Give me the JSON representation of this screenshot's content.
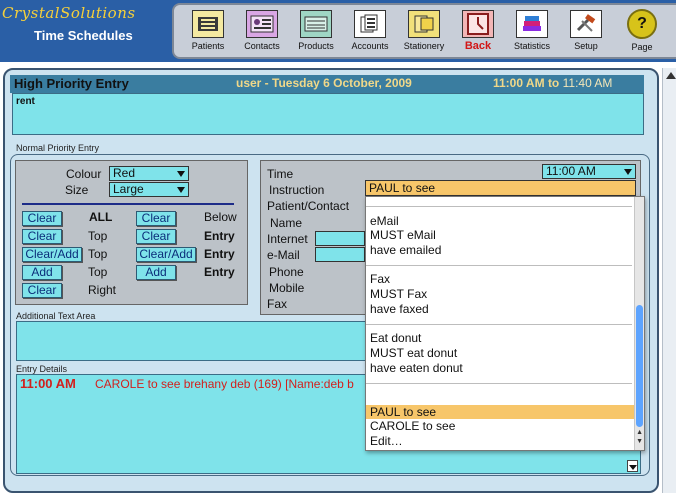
{
  "app": {
    "brand": "CrystalSolutions",
    "module_title": "Time Schedules"
  },
  "toolbar": {
    "buttons": [
      {
        "label": "Patients",
        "icon": "patients-icon"
      },
      {
        "label": "Contacts",
        "icon": "contacts-icon"
      },
      {
        "label": "Products",
        "icon": "products-icon"
      },
      {
        "label": "Accounts",
        "icon": "accounts-icon"
      },
      {
        "label": "Stationery",
        "icon": "stationery-icon"
      },
      {
        "label": "Back",
        "icon": "back-icon"
      },
      {
        "label": "Statistics",
        "icon": "statistics-icon"
      },
      {
        "label": "Setup",
        "icon": "setup-icon"
      },
      {
        "label": "Page",
        "icon": "page-help-icon"
      }
    ]
  },
  "high_priority": {
    "title": "High Priority Entry",
    "user_date": "user - Tuesday 6 October, 2009",
    "time_from": "11:00 AM",
    "time_to_word": "to",
    "time_to": "11:40 AM",
    "text": "rent"
  },
  "normal_priority": {
    "label": "Normal Priority Entry",
    "colour_label": "Colour",
    "colour_value": "Red",
    "size_label": "Size",
    "size_value": "Large",
    "buttons_left": [
      "Clear",
      "Clear",
      "Clear/Add",
      "Add",
      "Clear"
    ],
    "labels_left": [
      "ALL",
      "Top",
      "Top",
      "Top",
      "Right"
    ],
    "buttons_mid": [
      "Clear",
      "Clear",
      "Clear/Add",
      "Add"
    ],
    "labels_right": [
      "Below",
      "Entry",
      "Entry",
      "Entry"
    ]
  },
  "details": {
    "time_label": "Time",
    "time_value": "11:00 AM",
    "instruction_label": "Instruction",
    "instruction_value": "PAUL to see",
    "patient_contact_label": "Patient/Contact",
    "name_label": "Name",
    "internet_label": "Internet",
    "email_label": "e-Mail",
    "phone_label": "Phone",
    "mobile_label": "Mobile",
    "fax_label": "Fax"
  },
  "instruction_popup": {
    "groups": [
      [
        "eMail",
        "MUST eMail",
        "have emailed"
      ],
      [
        "Fax",
        "MUST Fax",
        "have faxed"
      ],
      [
        "Eat donut",
        "MUST eat donut",
        "have eaten donut"
      ],
      [
        "PAUL to see",
        "CAROLE to see",
        "Edit…"
      ]
    ],
    "selected": "PAUL to see"
  },
  "additional_text": {
    "label": "Additional Text Area"
  },
  "entry_details": {
    "label": "Entry Details",
    "time": "11:00 AM",
    "text": "CAROLE to see   brehany deb (169)  [Name:deb b"
  },
  "colors": {
    "header": "#2a5fa6",
    "field": "#7fe3ea",
    "highlight": "#f7c66a",
    "alert_red": "#d2201d"
  }
}
